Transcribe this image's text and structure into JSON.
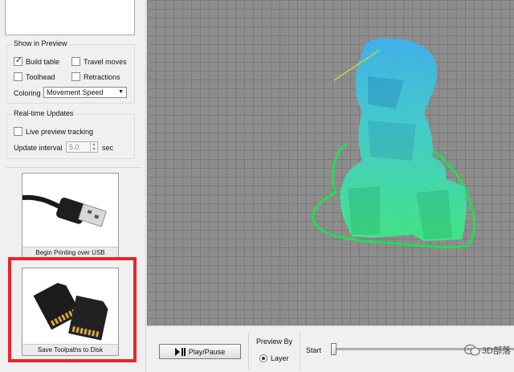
{
  "preview": {
    "title": "Show in Preview",
    "build_table": "Build table",
    "travel_moves": "Travel moves",
    "toolhead": "Toolhead",
    "retractions": "Retractions",
    "coloring_label": "Coloring",
    "coloring_value": "Movement Speed"
  },
  "realtime": {
    "title": "Real-time Updates",
    "live_tracking": "Live preview tracking",
    "interval_label": "Update interval",
    "interval_value": "5.0",
    "interval_unit": "sec"
  },
  "actions": {
    "usb_label": "Begin Printing over USB",
    "disk_label": "Save Toolpaths to Disk"
  },
  "bottom": {
    "play_label": "Play/Pause",
    "preview_by_title": "Preview By",
    "layer_label": "Layer",
    "start_label": "Start"
  },
  "watermark": {
    "text": "3D部落"
  },
  "colors": {
    "highlight": "#e8262b",
    "model_top": "#2ea8e6",
    "model_bottom": "#2fe07a"
  }
}
